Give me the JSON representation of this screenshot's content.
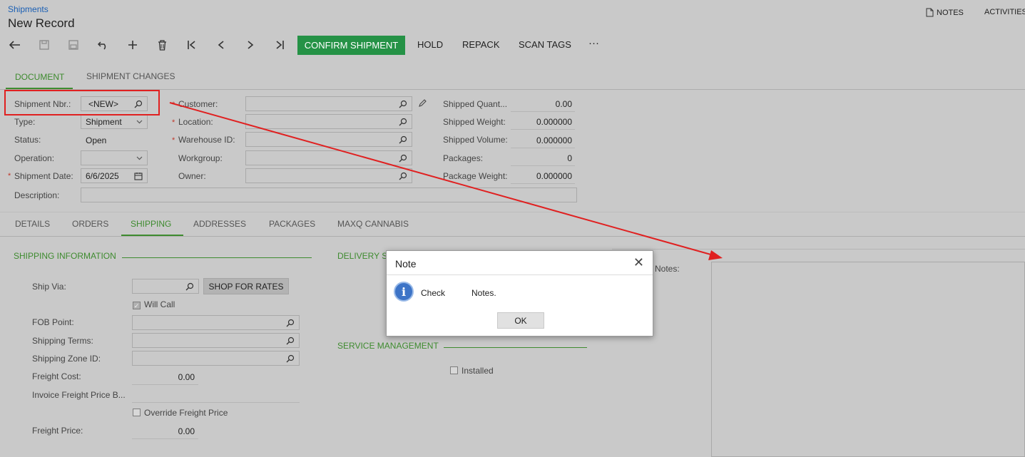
{
  "header": {
    "breadcrumb": "Shipments",
    "title": "New Record",
    "notes_label": "NOTES",
    "activities_label": "ACTIVITIES"
  },
  "toolbar": {
    "confirm_label": "CONFIRM SHIPMENT",
    "hold_label": "HOLD",
    "repack_label": "REPACK",
    "scan_tags_label": "SCAN TAGS",
    "more_label": "···"
  },
  "tabs": [
    {
      "label": "DOCUMENT",
      "active": true
    },
    {
      "label": "SHIPMENT CHANGES",
      "active": false
    }
  ],
  "form": {
    "shipment_nbr": {
      "label": "Shipment Nbr.:",
      "value": "<NEW>"
    },
    "type": {
      "label": "Type:",
      "value": "Shipment"
    },
    "status": {
      "label": "Status:",
      "value": "Open"
    },
    "operation": {
      "label": "Operation:",
      "value": ""
    },
    "shipment_date": {
      "label": "Shipment Date:",
      "value": "6/6/2025"
    },
    "description": {
      "label": "Description:",
      "value": ""
    },
    "customer": {
      "label": "Customer:",
      "value": ""
    },
    "location": {
      "label": "Location:",
      "value": ""
    },
    "warehouse": {
      "label": "Warehouse ID:",
      "value": ""
    },
    "workgroup": {
      "label": "Workgroup:",
      "value": ""
    },
    "owner": {
      "label": "Owner:",
      "value": ""
    },
    "shipped_qty": {
      "label": "Shipped Quant...",
      "value": "0.00"
    },
    "shipped_weight": {
      "label": "Shipped Weight:",
      "value": "0.000000"
    },
    "shipped_volume": {
      "label": "Shipped Volume:",
      "value": "0.000000"
    },
    "packages": {
      "label": "Packages:",
      "value": "0"
    },
    "package_weight": {
      "label": "Package Weight:",
      "value": "0.000000"
    }
  },
  "subtabs": [
    {
      "label": "DETAILS",
      "active": false
    },
    {
      "label": "ORDERS",
      "active": false
    },
    {
      "label": "SHIPPING",
      "active": true
    },
    {
      "label": "ADDRESSES",
      "active": false
    },
    {
      "label": "PACKAGES",
      "active": false
    },
    {
      "label": "MAXQ CANNABIS",
      "active": false
    }
  ],
  "shipping": {
    "section_title": "SHIPPING INFORMATION",
    "ship_via_label": "Ship Via:",
    "shop_rates_label": "SHOP FOR RATES",
    "will_call_label": "Will Call",
    "will_call_checked": true,
    "fob_label": "FOB Point:",
    "terms_label": "Shipping Terms:",
    "zone_label": "Shipping Zone ID:",
    "freight_cost_label": "Freight Cost:",
    "freight_cost_value": "0.00",
    "invoice_freight_label": "Invoice Freight Price B...",
    "override_label": "Override Freight Price",
    "freight_price_label": "Freight Price:",
    "freight_price_value": "0.00"
  },
  "delivery": {
    "section_title": "DELIVERY S",
    "notes_label": "Notes:"
  },
  "service": {
    "section_title": "SERVICE MANAGEMENT",
    "installed_label": "Installed"
  },
  "dialog": {
    "title": "Note",
    "message_prefix": "Check",
    "message_suffix": "Notes.",
    "ok_label": "OK"
  },
  "colors": {
    "accent_green": "#3e8b2f",
    "primary_button": "#259246",
    "annotation_red": "#e02020",
    "link_blue": "#1a5fb4"
  }
}
